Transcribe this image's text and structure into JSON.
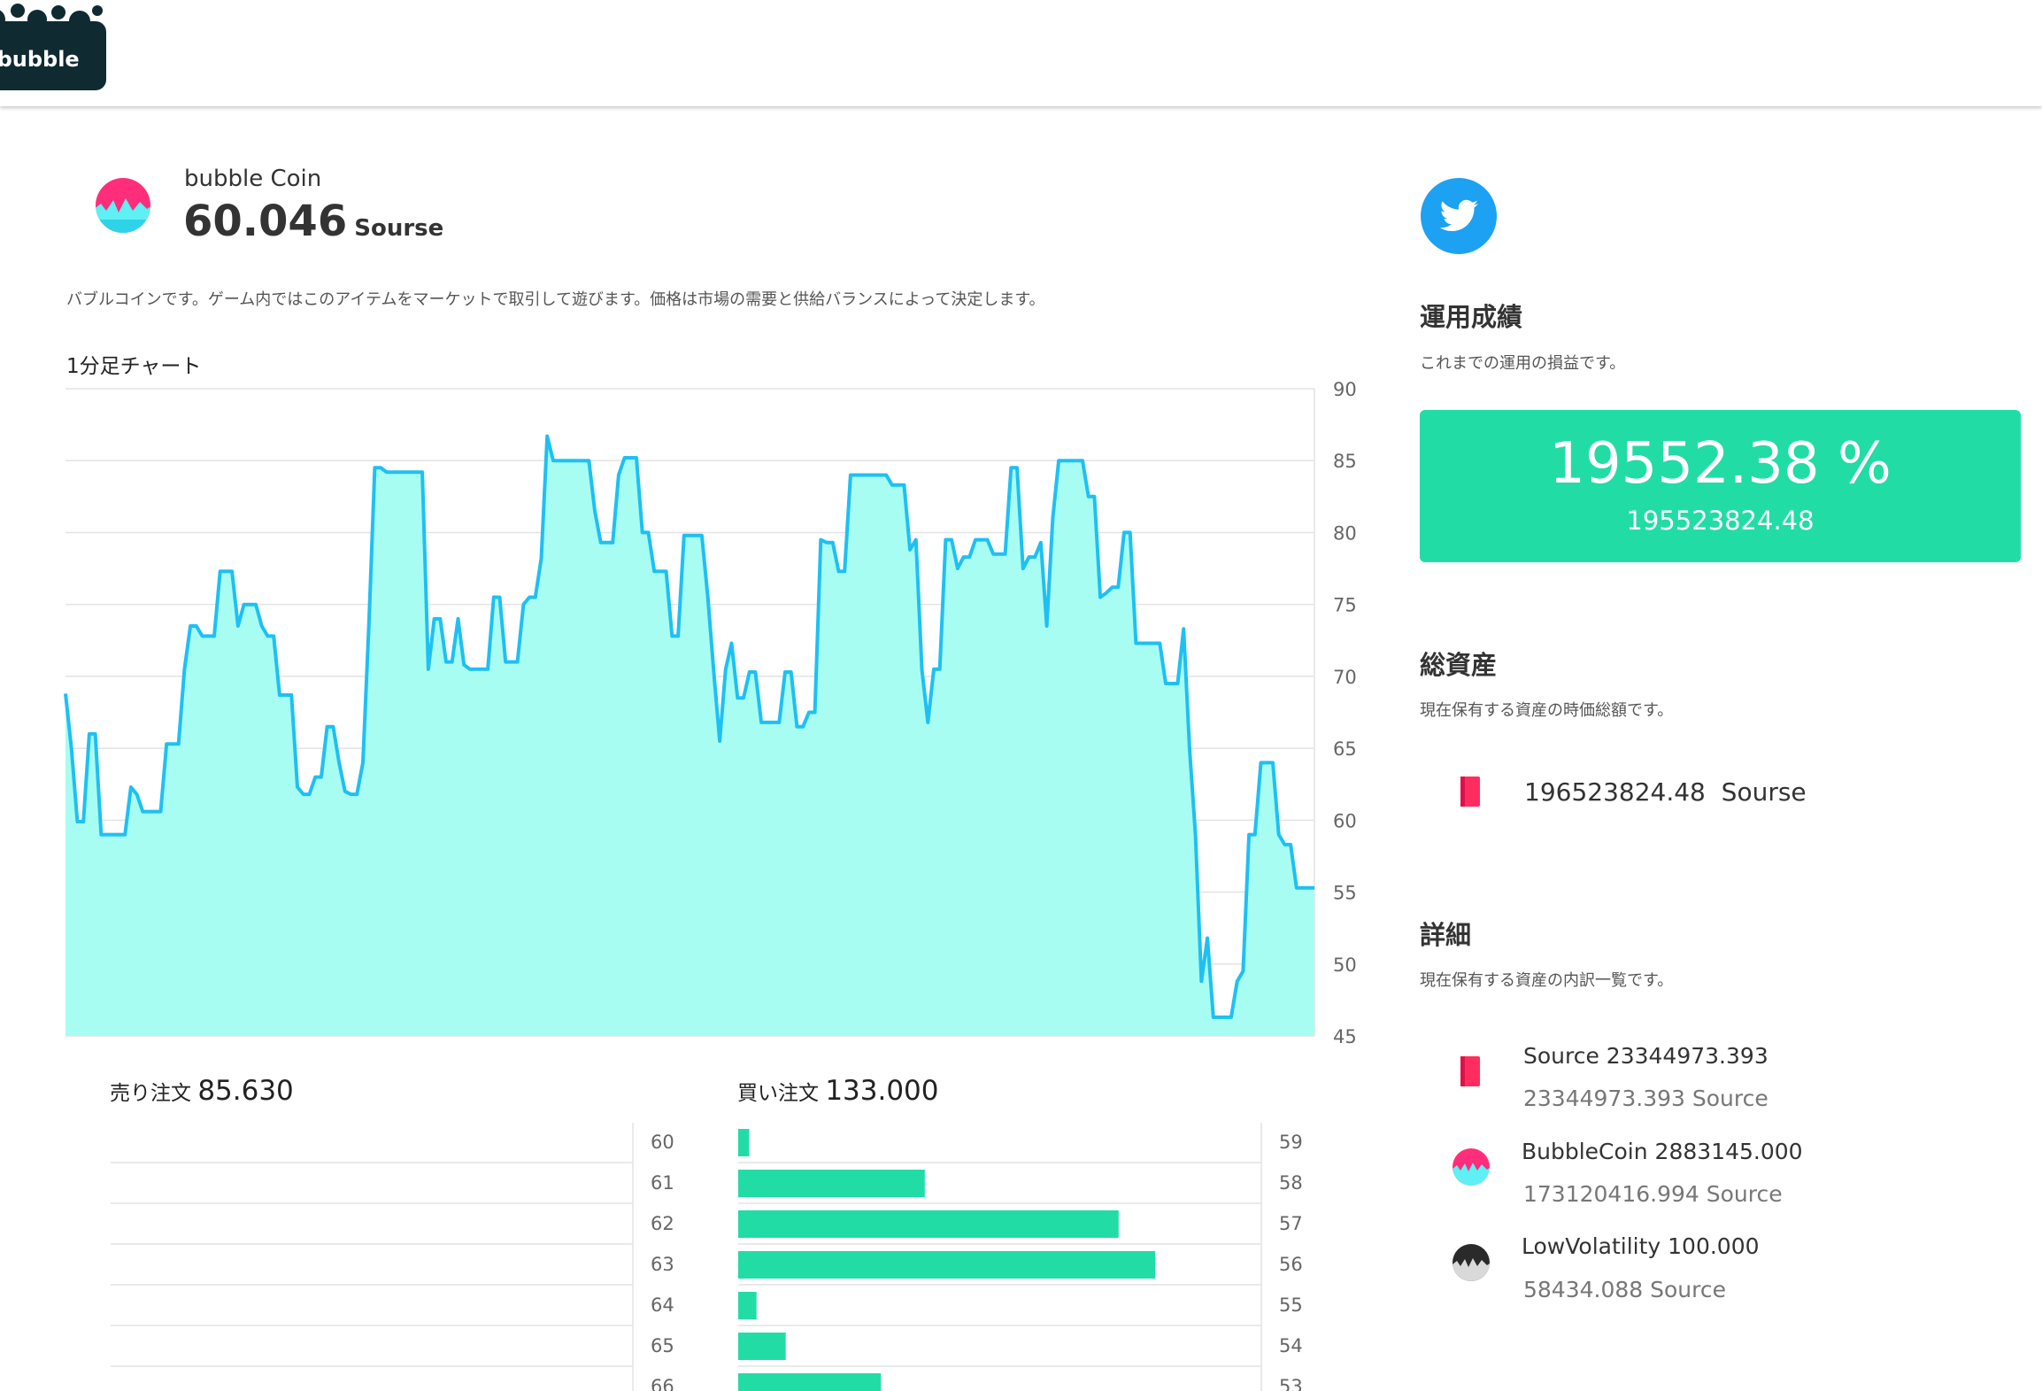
{
  "header": {
    "logo_text": "l bubble"
  },
  "coin": {
    "name": "bubble Coin",
    "price": "60.046",
    "unit": "Sourse",
    "description": "バブルコインです。ゲーム内ではこのアイテムをマーケットで取引して遊びます。価格は市場の需要と供給バランスによって決定します。"
  },
  "chart_title": "1分足チャート",
  "chart_data": {
    "type": "area",
    "ylim": [
      45,
      90
    ],
    "yticks": [
      90,
      85,
      80,
      75,
      70,
      65,
      60,
      55,
      50,
      45
    ],
    "grid": true,
    "color": "#1ec0f2",
    "fill": "#a8fdf2",
    "x": [
      0,
      1,
      2,
      3,
      4,
      5,
      6,
      7,
      8,
      9,
      10,
      11,
      12,
      13,
      14,
      15,
      16,
      17,
      18,
      19,
      20,
      21,
      22,
      23,
      24,
      25,
      26,
      27,
      28,
      29,
      30,
      31,
      32,
      33,
      34,
      35,
      36,
      37,
      38,
      39,
      40,
      41,
      42,
      43,
      44,
      45,
      46,
      47,
      48,
      49,
      50,
      51,
      52,
      53,
      54,
      55,
      56,
      57,
      58,
      59,
      60,
      61,
      62,
      63,
      64,
      65,
      66,
      67,
      68,
      69,
      70,
      71,
      72,
      73,
      74,
      75,
      76,
      77,
      78,
      79,
      80,
      81,
      82,
      83,
      84,
      85,
      86,
      87,
      88,
      89,
      90,
      91,
      92,
      93,
      94,
      95,
      96,
      97,
      98,
      99,
      100,
      101,
      102,
      103,
      104,
      105,
      106,
      107,
      108,
      109,
      110,
      111,
      112,
      113,
      114,
      115,
      116,
      117,
      118,
      119,
      120,
      121,
      122,
      123,
      124,
      125,
      126,
      127,
      128,
      129,
      130,
      131,
      132,
      133,
      134,
      135,
      136,
      137,
      138,
      139,
      140,
      141,
      142,
      143,
      144,
      145,
      146,
      147,
      148,
      149,
      150,
      151,
      152,
      153,
      154,
      155,
      156,
      157,
      158,
      159,
      160,
      161,
      162,
      163,
      164,
      165,
      166,
      167,
      168,
      169,
      170,
      171,
      172,
      173,
      174,
      175,
      176,
      177,
      178,
      179,
      180,
      181,
      182,
      183,
      184,
      185,
      186,
      187,
      188,
      189,
      190,
      191,
      192,
      193,
      194,
      195,
      196,
      197,
      198,
      199
    ],
    "y": [
      68.8,
      65,
      59.9,
      59.9,
      66,
      66,
      59,
      59,
      59,
      59,
      59,
      62.3,
      61.8,
      60.6,
      60.6,
      60.6,
      60.6,
      65.3,
      65.3,
      65.3,
      70.5,
      73.5,
      73.5,
      72.8,
      72.8,
      72.8,
      77.3,
      77.3,
      77.3,
      73.5,
      75,
      75,
      75,
      73.5,
      72.8,
      72.8,
      68.7,
      68.7,
      68.7,
      62.3,
      61.8,
      61.8,
      63,
      63,
      66.5,
      66.5,
      64,
      62,
      61.8,
      61.8,
      64,
      73.5,
      84.5,
      84.5,
      84.2,
      84.2,
      84.2,
      84.2,
      84.2,
      84.2,
      84.2,
      70.5,
      74,
      74,
      71,
      71,
      74,
      70.8,
      70.5,
      70.5,
      70.5,
      70.5,
      75.5,
      75.5,
      71,
      71,
      71,
      75,
      75.5,
      75.5,
      78.2,
      86.7,
      85,
      85,
      85,
      85,
      85,
      85,
      85,
      81.5,
      79.3,
      79.3,
      79.3,
      84,
      85.2,
      85.2,
      85.2,
      80,
      80,
      77.3,
      77.3,
      77.3,
      72.8,
      72.8,
      79.8,
      79.8,
      79.8,
      79.8,
      75.5,
      70.3,
      65.5,
      70.5,
      72.3,
      68.5,
      68.5,
      70.3,
      70.3,
      66.8,
      66.8,
      66.8,
      66.8,
      70.3,
      70.3,
      66.5,
      66.5,
      67.5,
      67.5,
      79.5,
      79.3,
      79.3,
      77.3,
      77.3,
      84,
      84,
      84,
      84,
      84,
      84,
      84,
      83.3,
      83.3,
      83.3,
      78.8,
      79.5,
      70.5,
      66.8,
      70.5,
      70.5,
      79.5,
      79.5,
      77.5,
      78.3,
      78.3,
      79.5,
      79.5,
      79.5,
      78.5,
      78.5,
      78.5,
      84.5,
      84.5,
      77.5,
      78.3,
      78.3,
      79.3,
      73.5,
      81,
      85,
      85,
      85,
      85,
      85,
      82.5,
      82.5,
      75.5,
      75.8,
      76.2,
      76.2,
      80,
      80,
      72.3,
      72.3,
      72.3,
      72.3,
      72.3,
      69.5,
      69.5,
      69.5,
      73.3,
      65,
      59,
      48.8,
      51.8,
      46.3,
      46.3,
      46.3,
      46.3,
      48.8,
      49.5,
      59,
      59,
      64,
      64,
      64,
      59,
      58.3,
      58.3,
      55.3,
      55.3,
      55.3,
      55.3
    ]
  },
  "sell_orders": {
    "label": "売り注文",
    "total": "85.630",
    "prices": [
      "60",
      "61",
      "62",
      "63",
      "64",
      "65",
      "66"
    ],
    "values": [
      0,
      0,
      0,
      0,
      0,
      0,
      0
    ]
  },
  "buy_orders": {
    "label": "買い注文",
    "total": "133.000",
    "prices": [
      "59",
      "58",
      "57",
      "56",
      "55",
      "54",
      "53"
    ],
    "values": [
      3,
      51,
      104,
      114,
      5,
      13,
      39
    ],
    "max": 143
  },
  "sidebar": {
    "twitter_icon": "twitter-bird-icon",
    "performance": {
      "title": "運用成績",
      "subtitle": "これまでの運用の損益です。",
      "percent": "19552.38 %",
      "value": "195523824.48",
      "color": "#22dca6"
    },
    "total_assets": {
      "title": "総資産",
      "subtitle": "現在保有する資産の時価総額です。",
      "value": "196523824.48",
      "unit": "Sourse"
    },
    "details": {
      "title": "詳細",
      "subtitle": "現在保有する資産の内訳一覧です。",
      "items": [
        {
          "icon": "source-book-icon",
          "name": "Source 23344973.393",
          "value": "23344973.393 Source"
        },
        {
          "icon": "bubblecoin-icon",
          "name": "BubbleCoin 2883145.000",
          "value": "173120416.994 Source"
        },
        {
          "icon": "lowvolatility-icon",
          "name": "LowVolatility 100.000",
          "value": "58434.088 Source"
        }
      ]
    }
  }
}
